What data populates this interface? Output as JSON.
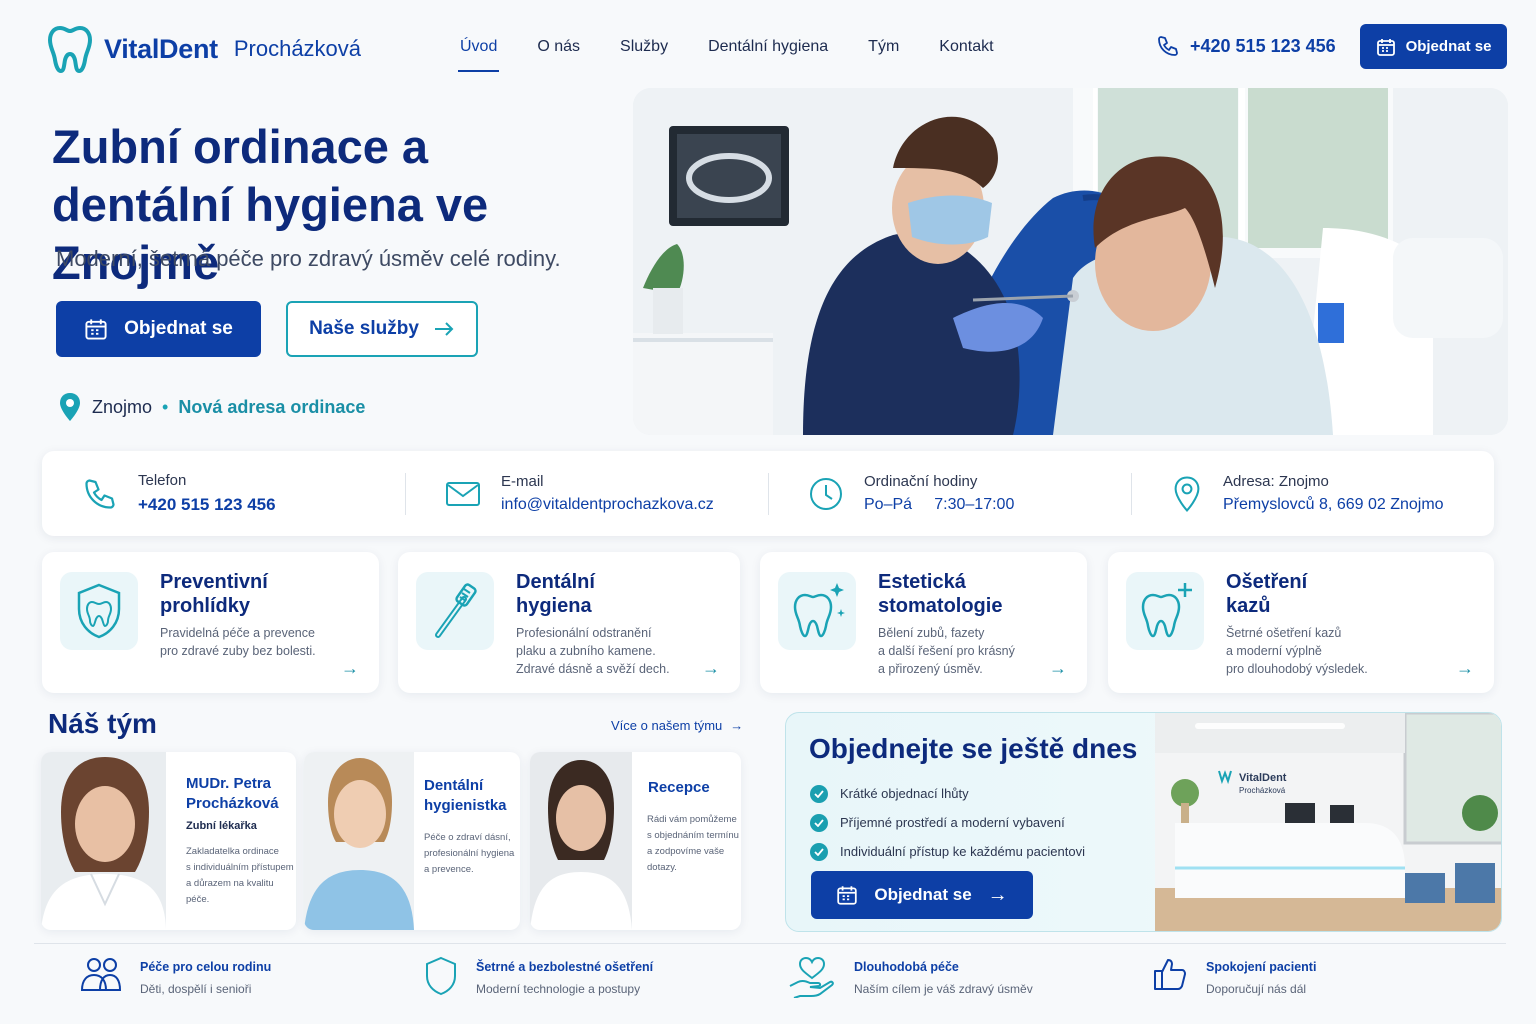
{
  "header": {
    "brand": "VitalDent",
    "brand_suffix": "Procházková",
    "nav": [
      "Úvod",
      "O nás",
      "Služby",
      "Dentální hygiena",
      "Tým",
      "Kontakt"
    ],
    "active_nav": "Úvod",
    "phone": "+420 515 123 456",
    "cta": "Objednat se"
  },
  "hero": {
    "title_line1": "Zubní ordinace a",
    "title_line2": "dentální hygiena ve Znojmě",
    "subtitle": "Moderní, šetrná péče pro zdravý úsměv celé rodiny.",
    "primary_button": "Objednat se",
    "secondary_button": "Naše služby",
    "location": "Znojmo",
    "location_separator": "•",
    "location_note": "Nová adresa ordinace"
  },
  "contact": [
    {
      "label": "Telefon",
      "value": "+420 515 123 456",
      "icon": "phone-icon"
    },
    {
      "label": "E-mail",
      "value": "info@vitaldentprochazkova.cz",
      "icon": "mail-icon"
    },
    {
      "label": "Ordinační hodiny",
      "value": "Po–Pá     7:30–17:00",
      "icon": "clock-icon"
    },
    {
      "label": "Adresa: Znojmo",
      "value": "Přemyslovců 8, 669 02 Znojmo",
      "icon": "location-pin-icon"
    }
  ],
  "services": [
    {
      "title_1": "Preventivní",
      "title_2": "prohlídky",
      "desc_1": "Pravidelná péče a prevence",
      "desc_2": "pro zdravé zuby bez bolesti.",
      "desc_3": "",
      "icon": "shield-tooth-icon"
    },
    {
      "title_1": "Dentální",
      "title_2": "hygiena",
      "desc_1": "Profesionální odstranění",
      "desc_2": "plaku a zubního kamene.",
      "desc_3": "Zdravé dásně a svěží dech.",
      "icon": "toothbrush-icon"
    },
    {
      "title_1": "Estetická",
      "title_2": "stomatologie",
      "desc_1": "Bělení zubů, fazety",
      "desc_2": "a další řešení pro krásný",
      "desc_3": "a přirozený úsměv.",
      "icon": "sparkle-tooth-icon"
    },
    {
      "title_1": "Ošetření",
      "title_2": "kazů",
      "desc_1": "Šetrné ošetření kazů",
      "desc_2": "a moderní výplně",
      "desc_3": "pro dlouhodobý výsledek.",
      "icon": "tooth-plus-icon"
    }
  ],
  "team": {
    "title": "Náš tým",
    "more": "Více o našem týmu",
    "members": [
      {
        "name_1": "MUDr. Petra",
        "name_2": "Procházková",
        "role": "Zubní lékařka",
        "desc_1": "Zakladatelka ordinace",
        "desc_2": "s individuálním přístupem",
        "desc_3": "a důrazem na kvalitu péče."
      },
      {
        "name_1": "Dentální",
        "name_2": "hygienistka",
        "role": "",
        "desc_1": "Péče o zdraví dásní,",
        "desc_2": "profesionální hygiena",
        "desc_3": "a prevence."
      },
      {
        "name_1": "Recepce",
        "name_2": "",
        "role": "",
        "desc_1": "Rádi vám pomůžeme",
        "desc_2": "s objednáním termínu",
        "desc_3": "a zodpovíme vaše",
        "desc_4": "dotazy."
      }
    ]
  },
  "cta": {
    "title": "Objednejte se ještě dnes",
    "points": [
      "Krátké objednací lhůty",
      "Příjemné prostředí a moderní vybavení",
      "Individuální přístup ke každému pacientovi"
    ],
    "button": "Objednat se",
    "sign_brand": "VitalDent",
    "sign_sub": "Procházková"
  },
  "features": [
    {
      "title": "Péče pro celou rodinu",
      "desc": "Děti, dospělí i senioři",
      "icon": "family-icon"
    },
    {
      "title": "Šetrné a bezbolestné ošetření",
      "desc": "Moderní technologie a postupy",
      "icon": "shield-icon"
    },
    {
      "title": "Dlouhodobá péče",
      "desc": "Naším cílem je váš zdravý úsměv",
      "icon": "heart-hand-icon"
    },
    {
      "title": "Spokojení pacienti",
      "desc": "Doporučují nás dál",
      "icon": "thumbs-up-icon"
    }
  ],
  "colors": {
    "primary": "#0d3fa6",
    "accent": "#1aa3b5",
    "heading": "#0d2a7c"
  }
}
